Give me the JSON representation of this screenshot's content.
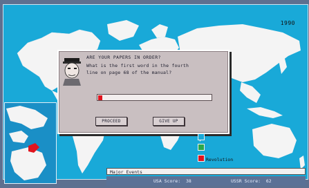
{
  "year": "1990",
  "dialog": {
    "title": "ARE YOUR PAPERS IN ORDER?",
    "question_line1": "What is the first word in the fourth",
    "question_line2": "line on page 68 of the manual?",
    "answer_value": "",
    "proceed_label": "PROCEED",
    "give_up_label": "GIVE UP"
  },
  "legend": {
    "colors": {
      "neutral": "#19a9d8",
      "status": "#29a84d",
      "revolution": "#e0141e"
    },
    "revolution_label": "Revolution"
  },
  "events": {
    "label": "Major Events"
  },
  "scores": {
    "usa_label": "USA Score:",
    "usa_value": "38",
    "ussr_label": "USSR Score:",
    "ussr_value": "62"
  },
  "map": {
    "ocean_color": "#19a9d8",
    "land_color": "#f4f4f4",
    "highlight_color": "#e0141e"
  }
}
